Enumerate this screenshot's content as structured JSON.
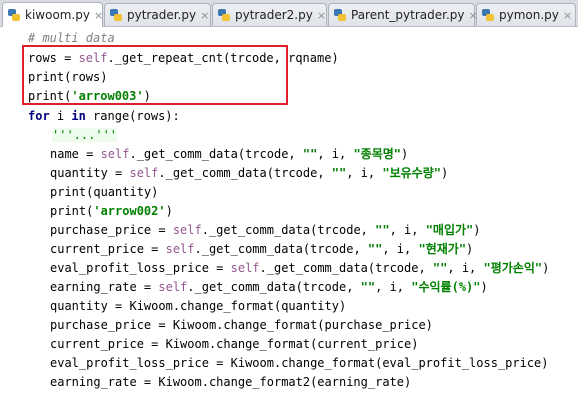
{
  "tabs": [
    {
      "label": "kiwoom.py",
      "active": true
    },
    {
      "label": "pytrader.py",
      "active": false
    },
    {
      "label": "pytrader2.py",
      "active": false
    },
    {
      "label": "Parent_pytrader.py",
      "active": false
    },
    {
      "label": "pymon.py",
      "active": false
    }
  ],
  "tab_close_glyph": "×",
  "code": {
    "comment": "# multi data",
    "rows_var": "rows = ",
    "self1": "self",
    "rows_call": "._get_repeat_cnt(trcode, rqname)",
    "print_rows": "print(rows)",
    "print_arrow_open": "print(",
    "arrow003": "'arrow003'",
    "print_close": ")",
    "for_kw": "for",
    "for_i": " i ",
    "in_kw": "in",
    "for_rest": " range(rows):",
    "docstr": "'''...'''",
    "lines": [
      {
        "pre": "name = ",
        "self": "self",
        "call": "._get_comm_data(trcode, ",
        "empty": "\"\"",
        "mid": ", i, ",
        "str": "\"종목명\"",
        "post": ")"
      },
      {
        "pre": "quantity = ",
        "self": "self",
        "call": "._get_comm_data(trcode, ",
        "empty": "\"\"",
        "mid": ", i, ",
        "str": "\"보유수량\"",
        "post": ")"
      }
    ],
    "print_quantity": "print(quantity)",
    "arrow002": "'arrow002'",
    "lines2": [
      {
        "pre": "purchase_price = ",
        "self": "self",
        "call": "._get_comm_data(trcode, ",
        "empty": "\"\"",
        "mid": ", i, ",
        "str": "\"매입가\"",
        "post": ")"
      },
      {
        "pre": "current_price = ",
        "self": "self",
        "call": "._get_comm_data(trcode, ",
        "empty": "\"\"",
        "mid": ", i, ",
        "str": "\"현재가\"",
        "post": ")"
      },
      {
        "pre": "eval_profit_loss_price = ",
        "self": "self",
        "call": "._get_comm_data(trcode, ",
        "empty": "\"\"",
        "mid": ", i, ",
        "str": "\"평가손익\"",
        "post": ")"
      },
      {
        "pre": "earning_rate = ",
        "self": "self",
        "call": "._get_comm_data(trcode, ",
        "empty": "\"\"",
        "mid": ", i, ",
        "str": "\"수익률(%)\"",
        "post": ")"
      }
    ],
    "format_lines": [
      "quantity = Kiwoom.change_format(quantity)",
      "purchase_price = Kiwoom.change_format(purchase_price)",
      "current_price = Kiwoom.change_format(current_price)",
      "eval_profit_loss_price = Kiwoom.change_format(eval_profit_loss_price)",
      "earning_rate = Kiwoom.change_format2(earning_rate)"
    ]
  },
  "colors": {
    "keyword": "#000080",
    "self": "#94558d",
    "string": "#008000",
    "highlight_border": "#e01f2a"
  }
}
